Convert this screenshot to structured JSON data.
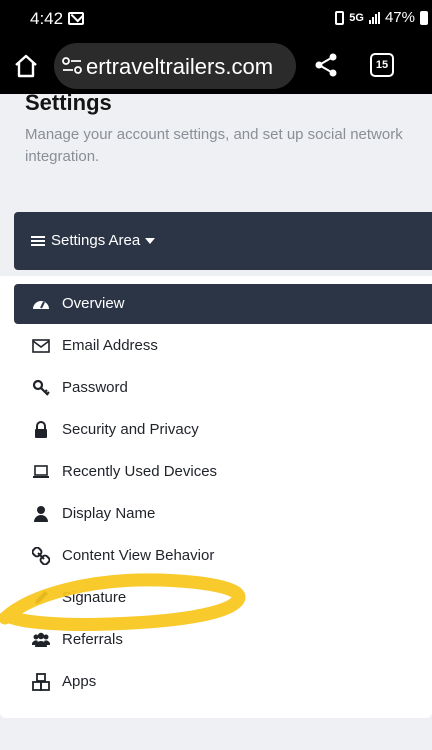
{
  "status_bar": {
    "time": "4:42",
    "network": "5G",
    "battery": "47%"
  },
  "browser": {
    "url": "ertraveltrailers.com",
    "tab_count": "15"
  },
  "page": {
    "title": "Settings",
    "description": "Manage your account settings, and set up social network integration."
  },
  "settings_area": {
    "label": "Settings Area"
  },
  "nav": {
    "items": [
      {
        "label": "Overview",
        "icon": "dashboard-icon",
        "active": true
      },
      {
        "label": "Email Address",
        "icon": "envelope-icon"
      },
      {
        "label": "Password",
        "icon": "key-icon"
      },
      {
        "label": "Security and Privacy",
        "icon": "lock-icon"
      },
      {
        "label": "Recently Used Devices",
        "icon": "laptop-icon"
      },
      {
        "label": "Display Name",
        "icon": "user-icon"
      },
      {
        "label": "Content View Behavior",
        "icon": "link-icon"
      },
      {
        "label": "Signature",
        "icon": "pen-icon"
      },
      {
        "label": "Referrals",
        "icon": "users-icon"
      },
      {
        "label": "Apps",
        "icon": "cubes-icon"
      }
    ]
  },
  "colors": {
    "nav_dark": "#2c3545",
    "page_bg": "#eef0f3",
    "highlight": "#f7c51a"
  }
}
